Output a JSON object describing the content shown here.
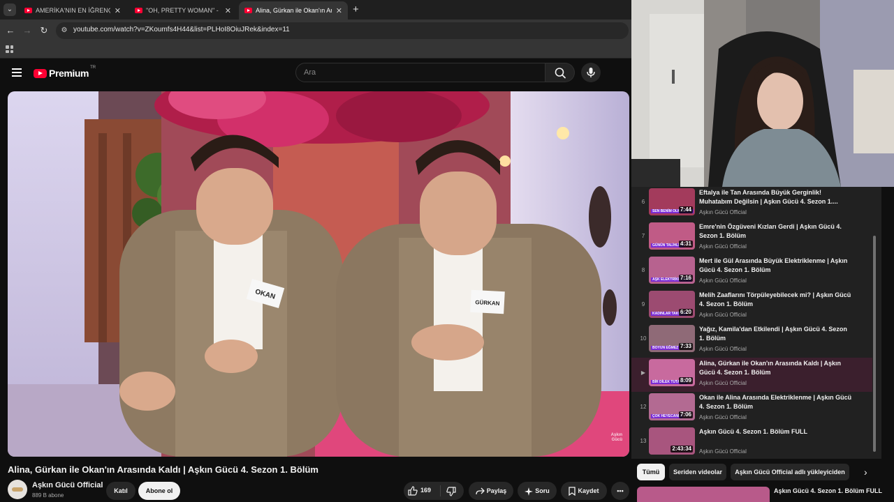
{
  "browser": {
    "tabs": [
      {
        "title": "AMERİKA'NIN EN İĞRENÇ PROG",
        "active": false
      },
      {
        "title": "\"OH, PRETTY WOMAN\" - Roy O",
        "active": false
      },
      {
        "title": "Alina, Gürkan ile Okan'ın Arasınd",
        "active": true
      }
    ],
    "url": "youtube.com/watch?v=ZKoumfs4H44&list=PLHoI8OiuJRek&index=11"
  },
  "youtube": {
    "logo_text": "Premium",
    "country_code": "TR",
    "search_placeholder": "Ara"
  },
  "player": {
    "badge_okan": "OKAN",
    "badge_gurkan": "GÜRKAN",
    "watermark_line1": "Aşkın",
    "watermark_line2": "Gücü"
  },
  "video": {
    "title": "Alina, Gürkan ile Okan'ın Arasında Kaldı | Aşkın Gücü 4. Sezon 1. Bölüm",
    "channel": "Aşkın Gücü Official",
    "subscribers": "889 B abone",
    "join_label": "Katıl",
    "subscribe_label": "Abone ol",
    "likes": "169",
    "share_label": "Paylaş",
    "ask_label": "Soru",
    "save_label": "Kaydet"
  },
  "playlist": {
    "items": [
      {
        "index": "6",
        "title": "Eftalya ile Tan Arasında Büyük Gerginlik! Muhatabım Değilsin | Aşkın Gücü 4. Sezon 1....",
        "channel": "Aşkın Gücü Official",
        "duration": "7:44",
        "current": false,
        "thumb_color": "#a33b5c"
      },
      {
        "index": "7",
        "title": "Emre'nin Özgüveni Kızları Gerdi | Aşkın Gücü 4. Sezon 1. Bölüm",
        "channel": "Aşkın Gücü Official",
        "duration": "4:31",
        "current": false,
        "thumb_color": "#c05b86"
      },
      {
        "index": "8",
        "title": "Mert ile Gül Arasında Büyük Elektriklenme | Aşkın Gücü 4. Sezon 1. Bölüm",
        "channel": "Aşkın Gücü Official",
        "duration": "7:16",
        "current": false,
        "thumb_color": "#b7628f"
      },
      {
        "index": "9",
        "title": "Melih Zaaflarını Törpüleyebilecek mi? | Aşkın Gücü 4. Sezon 1. Bölüm",
        "channel": "Aşkın Gücü Official",
        "duration": "6:20",
        "current": false,
        "thumb_color": "#9c4b71"
      },
      {
        "index": "10",
        "title": "Yağız, Kamila'dan Etkilendi | Aşkın Gücü 4. Sezon 1. Bölüm",
        "channel": "Aşkın Gücü Official",
        "duration": "7:33",
        "current": false,
        "thumb_color": "#8f6a77"
      },
      {
        "index": "",
        "title": "Alina, Gürkan ile Okan'ın Arasında Kaldı | Aşkın Gücü 4. Sezon 1. Bölüm",
        "channel": "Aşkın Gücü Official",
        "duration": "8:09",
        "current": true,
        "thumb_color": "#c86a9e"
      },
      {
        "index": "12",
        "title": "Okan ile Alina Arasında Elektriklenme | Aşkın Gücü 4. Sezon 1. Bölüm",
        "channel": "Aşkın Gücü Official",
        "duration": "7:06",
        "current": false,
        "thumb_color": "#b36a92"
      },
      {
        "index": "13",
        "title": "Aşkın Gücü 4. Sezon 1. Bölüm FULL",
        "channel": "Aşkın Gücü Official",
        "duration": "2:43:34",
        "current": false,
        "thumb_color": "#a8557e"
      }
    ],
    "thumb_captions": [
      "SEN BENİM OLMALISIN",
      "GÜNÜN TALİHLİSİ",
      "AŞK ELEKTRİKLENME",
      "KADINLAR TAKILIR",
      "BOYUN EĞMEZ",
      "BİR DİLEK TUTAYIM",
      "ÇOK HEYECANLI",
      ""
    ]
  },
  "chips": [
    {
      "label": "Tümü",
      "selected": true
    },
    {
      "label": "Seriden videolar",
      "selected": false
    },
    {
      "label": "Aşkın Gücü Official adlı yükleyiciden",
      "selected": false
    }
  ],
  "recommendation": {
    "title": "Aşkın Gücü 4. Sezon 1. Bölüm FULL"
  },
  "icons": {
    "tab_menu": "chevron-down-icon",
    "back": "arrow-left-icon",
    "forward": "arrow-right-icon",
    "reload": "reload-icon",
    "site_info": "tune-icon",
    "apps": "apps-grid-icon",
    "menu": "hamburger-icon",
    "search": "search-icon",
    "mic": "mic-icon",
    "like": "thumbs-up-icon",
    "dislike": "thumbs-down-icon",
    "share": "share-arrow-icon",
    "ask": "sparkle-icon",
    "save": "bookmark-icon",
    "more": "more-horizontal-icon",
    "play_indicator": "play-icon",
    "chips_next": "chevron-right-icon"
  },
  "colors": {
    "brand_red": "#ff0033",
    "background": "#0f0f0f",
    "current_row": "#3b1f2d"
  }
}
